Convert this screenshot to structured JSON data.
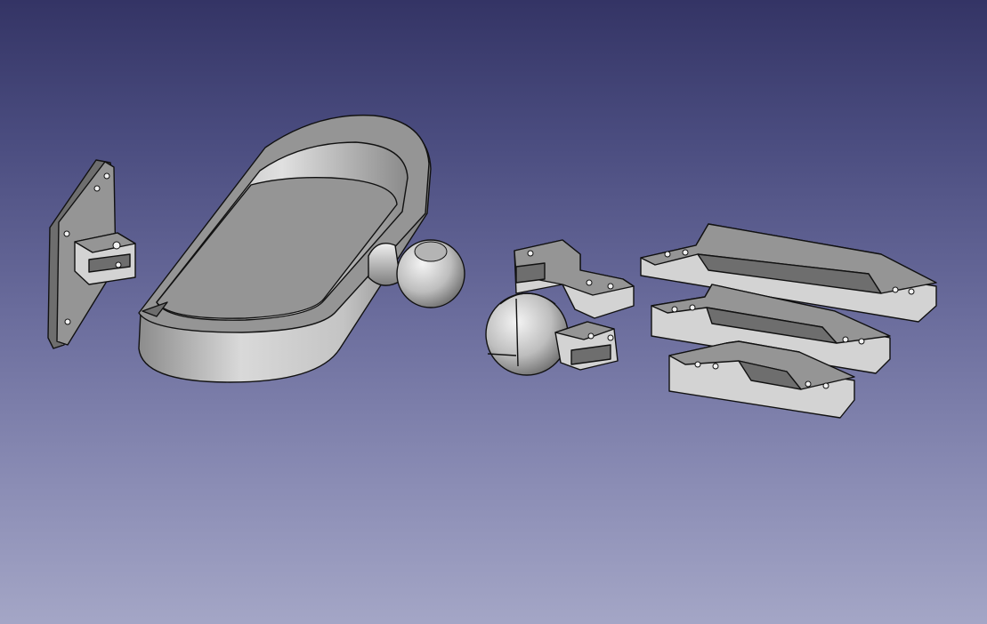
{
  "viewport": {
    "background_top": "#343465",
    "background_bottom": "#a4a6c6"
  },
  "scene": {
    "parts": [
      {
        "name": "wall-mount-plate"
      },
      {
        "name": "oval-ring-bracket"
      },
      {
        "name": "ball-joint"
      },
      {
        "name": "socket-cap-assembly"
      },
      {
        "name": "long-connector-bar"
      },
      {
        "name": "medium-connector-bar"
      },
      {
        "name": "short-connector-bar"
      }
    ],
    "face_color_light": "#d3d3d3",
    "face_color_mid": "#959595",
    "face_color_dark": "#6e6e6e"
  }
}
